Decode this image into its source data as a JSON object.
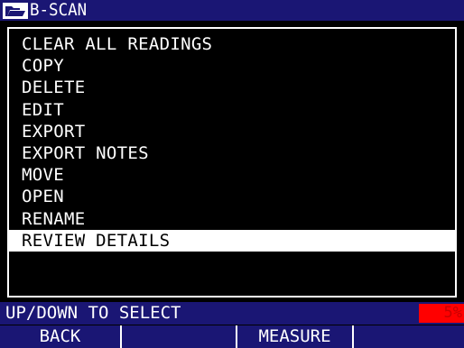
{
  "title_bar": {
    "title": "B-SCAN",
    "icon": "folder-open-icon"
  },
  "menu": {
    "items": [
      "CLEAR ALL READINGS",
      "COPY",
      "DELETE",
      "EDIT",
      "EXPORT",
      "EXPORT NOTES",
      "MOVE",
      "OPEN",
      "RENAME",
      "REVIEW DETAILS"
    ],
    "selected": "REVIEW DETAILS"
  },
  "status": {
    "text": "UP/DOWN TO SELECT",
    "battery": "5%"
  },
  "softkeys": [
    "BACK",
    "",
    "MEASURE",
    ""
  ],
  "colors": {
    "bar_blue": "#1a1674",
    "background": "#000000",
    "highlight": "#ffffff",
    "battery_red": "#ff0000"
  }
}
